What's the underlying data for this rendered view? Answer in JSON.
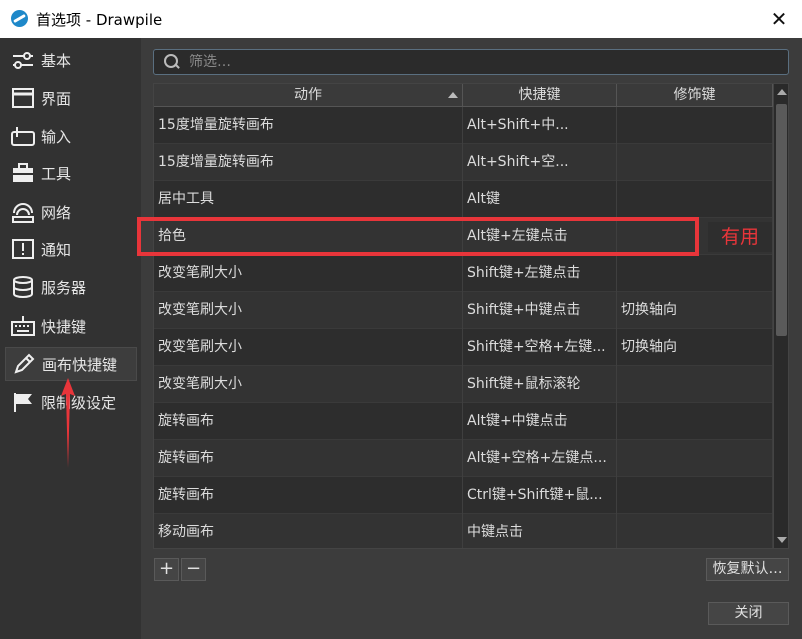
{
  "window": {
    "title": "首选项 - Drawpile",
    "close_glyph": "✕"
  },
  "sidebar": {
    "items": [
      {
        "label": "基本",
        "icon": "sliders-icon"
      },
      {
        "label": "界面",
        "icon": "window-icon"
      },
      {
        "label": "输入",
        "icon": "tablet-icon"
      },
      {
        "label": "工具",
        "icon": "toolbox-icon"
      },
      {
        "label": "网络",
        "icon": "network-icon"
      },
      {
        "label": "通知",
        "icon": "notification-icon"
      },
      {
        "label": "服务器",
        "icon": "database-icon"
      },
      {
        "label": "快捷键",
        "icon": "keyboard-icon"
      },
      {
        "label": "画布快捷键",
        "icon": "pencil-icon",
        "active": true
      },
      {
        "label": "限制级设定",
        "icon": "flag-icon"
      }
    ]
  },
  "search": {
    "placeholder": "筛选…"
  },
  "table": {
    "columns": [
      "动作",
      "快捷键",
      "修饰键"
    ],
    "rows": [
      {
        "action": "15度增量旋转画布",
        "shortcut": "Alt+Shift+中...",
        "modifier": ""
      },
      {
        "action": "15度增量旋转画布",
        "shortcut": "Alt+Shift+空...",
        "modifier": ""
      },
      {
        "action": "居中工具",
        "shortcut": "Alt键",
        "modifier": ""
      },
      {
        "action": "拾色",
        "shortcut": "Alt键+左键点击",
        "modifier": ""
      },
      {
        "action": "改变笔刷大小",
        "shortcut": "Shift键+左键点击",
        "modifier": ""
      },
      {
        "action": "改变笔刷大小",
        "shortcut": "Shift键+中键点击",
        "modifier": "切换轴向"
      },
      {
        "action": "改变笔刷大小",
        "shortcut": "Shift键+空格+左键...",
        "modifier": "切换轴向"
      },
      {
        "action": "改变笔刷大小",
        "shortcut": "Shift键+鼠标滚轮",
        "modifier": ""
      },
      {
        "action": "旋转画布",
        "shortcut": "Alt键+中键点击",
        "modifier": ""
      },
      {
        "action": "旋转画布",
        "shortcut": "Alt键+空格+左键点...",
        "modifier": ""
      },
      {
        "action": "旋转画布",
        "shortcut": "Ctrl键+Shift键+鼠...",
        "modifier": ""
      },
      {
        "action": "移动画布",
        "shortcut": "中键点击",
        "modifier": ""
      }
    ]
  },
  "buttons": {
    "add": "+",
    "remove": "−",
    "restore_defaults": "恢复默认…",
    "close": "关闭"
  },
  "annotation": {
    "label": "有用",
    "color": "#e8353a"
  }
}
